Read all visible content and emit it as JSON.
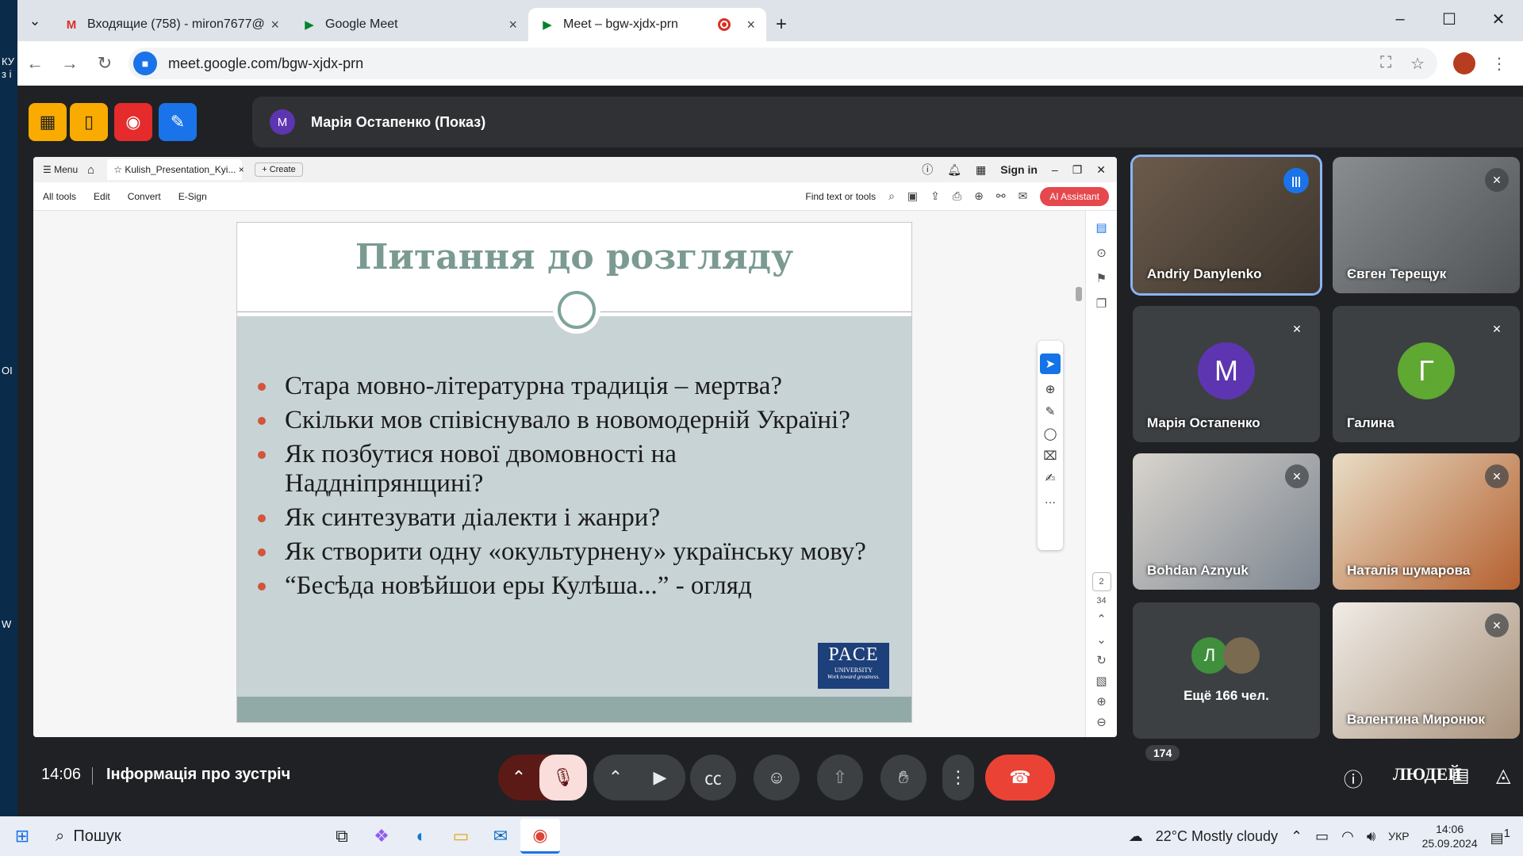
{
  "browser": {
    "tabs": [
      {
        "title": "Входящие (758) - miron7677@",
        "icon": "gmail-icon"
      },
      {
        "title": "Google Meet",
        "icon": "meet-icon"
      },
      {
        "title": "Meet – bgw-xjdx-prn",
        "icon": "meet-icon",
        "active": true
      }
    ],
    "url": "meet.google.com/bgw-xjdx-prn"
  },
  "left_strip": [
    "КУ",
    "з і",
    "OI",
    "W"
  ],
  "meet": {
    "presenter": {
      "initial": "M",
      "name": "Марія Остапенко (Показ)"
    },
    "participants": [
      {
        "name": "Andriy Danylenko",
        "video": true,
        "speaking": true
      },
      {
        "name": "Євген Терещук",
        "video": true,
        "muted": true
      },
      {
        "name": "Марія Остапенко",
        "initial": "M",
        "color": "#5e35b1",
        "muted": true
      },
      {
        "name": "Галина",
        "initial": "Г",
        "color": "#5fa832",
        "muted": true
      },
      {
        "name": "Bohdan Aznyuk",
        "video": true,
        "muted": true
      },
      {
        "name": "Наталія шумарова",
        "video": true,
        "muted": true
      },
      {
        "name": "Ещё 166 чел.",
        "initial": "Л",
        "color": "#3f8f3c"
      },
      {
        "name": "Валентина Миронюк",
        "video": true,
        "muted": true
      }
    ],
    "time": "14:06",
    "meeting_info": "Інформація про зустріч",
    "people_count": "174",
    "people_label": "ЛЮДЕЙ"
  },
  "acrobat": {
    "menu": "Menu",
    "doc_tab": "Kulish_Presentation_Kyi...",
    "create": "Create",
    "sign_in": "Sign in",
    "menus": [
      "All tools",
      "Edit",
      "Convert",
      "E-Sign"
    ],
    "find": "Find text or tools",
    "ai": "AI Assistant",
    "page": "2",
    "total": "34"
  },
  "slide": {
    "title": "Питання до розгляду",
    "bullets": [
      "Стара мовно-літературна традиція – мертва?",
      "Скільки мов співіснувало в новомодерній Україні?",
      "Як позбутися нової двомовності на Наддніпрянщині?",
      "Як синтезувати діалекти і жанри?",
      "Як створити одну «окультурнену» українську мову?",
      "“Бесѣда новѣйшои еры Кулѣша...” - огляд"
    ],
    "logo": {
      "main": "PACE",
      "sub": "UNIVERSITY",
      "tagline": "Work toward greatness."
    }
  },
  "taskbar": {
    "search": "Пошук",
    "weather": "22°C  Mostly cloudy",
    "lang": "УКР",
    "time": "14:06",
    "date": "25.09.2024",
    "notif": "1"
  }
}
